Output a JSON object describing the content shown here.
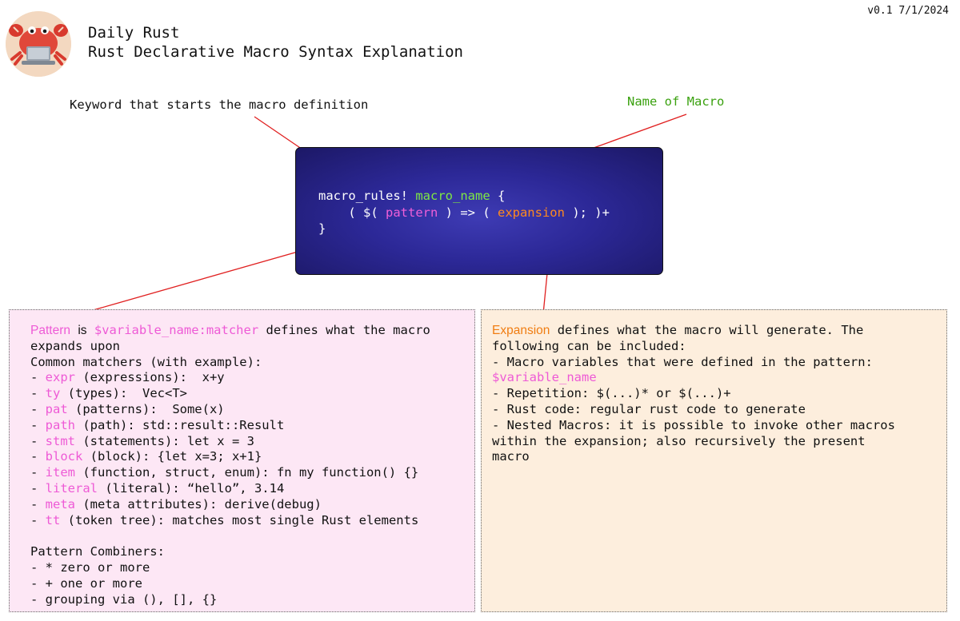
{
  "header": {
    "series": "Daily Rust",
    "title": "Rust Declarative Macro Syntax Explanation",
    "version": "v0.1 7/1/2024"
  },
  "callouts": {
    "keyword": "Keyword that starts the macro definition",
    "name": "Name of Macro"
  },
  "code": {
    "keyword": "macro_rules!",
    "macro_name": "macro_name",
    "open_brace": "{",
    "line2_start": "    ( $( ",
    "pattern": "pattern",
    "line2_mid": " ) => ( ",
    "expansion": "expansion",
    "line2_end": " ); )+",
    "close_brace": "}"
  },
  "pattern_box": {
    "intro_word": "Pattern",
    "intro_is": "is",
    "intro_code": "$variable_name:matcher",
    "intro_rest": " defines what the macro",
    "intro_line2": "expands upon",
    "matchers_heading": "Common matchers (with example):",
    "matchers": [
      {
        "name": "expr",
        "desc": " (expressions):  x+y"
      },
      {
        "name": "ty",
        "desc": " (types):  Vec<T>"
      },
      {
        "name": "pat",
        "desc": " (patterns):  Some(x)"
      },
      {
        "name": "path",
        "desc": " (path): std::result::Result"
      },
      {
        "name": "stmt",
        "desc": " (statements): let x = 3"
      },
      {
        "name": "block",
        "desc": " (block): {let x=3; x+1}"
      },
      {
        "name": "item",
        "desc": " (function, struct, enum): fn my function() {}"
      },
      {
        "name": "literal",
        "desc": " (literal): “hello”, 3.14"
      },
      {
        "name": "meta",
        "desc": " (meta attributes): derive(debug)"
      },
      {
        "name": "tt",
        "desc": " (token tree): matches most single Rust elements"
      }
    ],
    "combiners_heading": "Pattern Combiners:",
    "combiners": [
      "- * zero or more",
      "- + one or more",
      "- grouping via (), [], {}"
    ]
  },
  "expansion_box": {
    "intro_word": "Expansion",
    "intro_rest": " defines what the macro will generate. The",
    "line2": "following can be included:",
    "line3": "- Macro variables that were defined in the pattern:",
    "var_name": "$variable_name",
    "line5": "- Repetition: $(...)* or $(...)+",
    "line6": "- Rust code: regular rust code to generate",
    "line7": "- Nested Macros: it is possible to invoke other macros",
    "line8": "within the expansion; also recursively the present",
    "line9": "macro"
  },
  "colors": {
    "code_bg": "#2c2897",
    "name_green": "#3aa10f",
    "pattern_pink": "#ee5ad6",
    "expansion_orange": "#f07d12",
    "pattern_box_bg": "#fde7f5",
    "expansion_box_bg": "#fdeedd",
    "leader_red": "#e02020"
  },
  "icons": {
    "logo": "crab-with-laptop-icon"
  }
}
